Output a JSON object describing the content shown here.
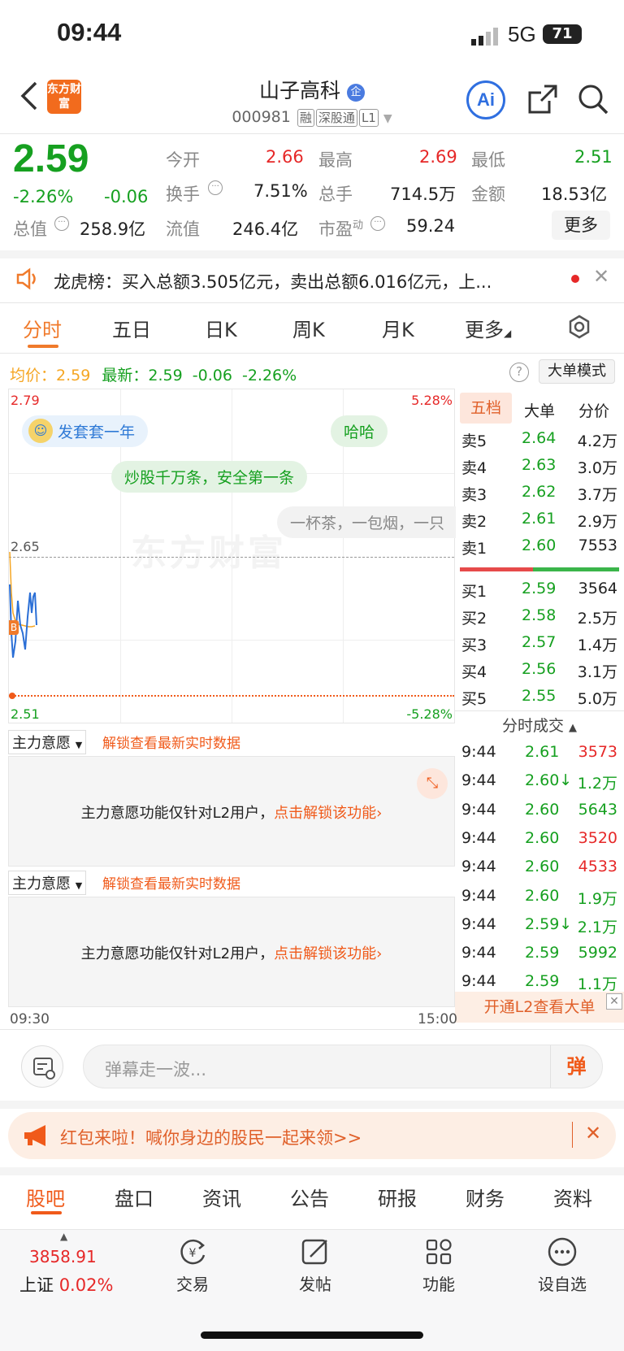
{
  "status": {
    "time": "09:44",
    "network": "5G",
    "battery": "71"
  },
  "header": {
    "title": "山子高科",
    "title_badge": "企",
    "code": "000981",
    "tags": [
      "融",
      "深股通",
      "L1"
    ],
    "logo_text": "东方财富",
    "ai_label": "Ai"
  },
  "quote": {
    "price": "2.59",
    "change_pct": "-2.26%",
    "change": "-0.06",
    "open_label": "今开",
    "open": "2.66",
    "high_label": "最高",
    "high": "2.69",
    "low_label": "最低",
    "low": "2.51",
    "turnover_label": "换手",
    "turnover": "7.51%",
    "volume_label": "总手",
    "volume": "714.5万",
    "amount_label": "金额",
    "amount": "18.53亿",
    "mktcap_label": "总值",
    "mktcap": "258.9亿",
    "float_label": "流值",
    "float": "246.4亿",
    "pe_label": "市盈",
    "pe_sup": "动",
    "pe": "59.24",
    "more": "更多"
  },
  "notice": {
    "text": "龙虎榜：买入总额3.505亿元，卖出总额6.016亿元，上..."
  },
  "chart_tabs": [
    "分时",
    "五日",
    "日K",
    "周K",
    "月K",
    "更多"
  ],
  "chart_info": {
    "avg_label": "均价：",
    "avg": "2.59",
    "latest_label": "最新：",
    "latest": "2.59",
    "chg": "-0.06",
    "pct": "-2.26%",
    "mode_btn": "大单模式"
  },
  "chart": {
    "y_max": "2.79",
    "y_max_pct": "5.28%",
    "y_mid": "2.65",
    "y_min": "2.51",
    "y_min_pct": "-5.28%",
    "t_start": "09:30",
    "t_end": "15:00",
    "watermark": "东方财富",
    "marker": "B"
  },
  "danmaku": [
    "发套套一年",
    "哈哈",
    "炒股千万条，安全第一条",
    "一杯茶，一包烟，一只"
  ],
  "order_book": {
    "tabs": [
      "五档",
      "大单",
      "分价"
    ],
    "asks": [
      {
        "label": "卖5",
        "price": "2.64",
        "vol": "4.2万"
      },
      {
        "label": "卖4",
        "price": "2.63",
        "vol": "3.0万"
      },
      {
        "label": "卖3",
        "price": "2.62",
        "vol": "3.7万"
      },
      {
        "label": "卖2",
        "price": "2.61",
        "vol": "2.9万"
      },
      {
        "label": "卖1",
        "price": "2.60",
        "vol": "7553"
      }
    ],
    "bids": [
      {
        "label": "买1",
        "price": "2.59",
        "vol": "3564"
      },
      {
        "label": "买2",
        "price": "2.58",
        "vol": "2.5万"
      },
      {
        "label": "买3",
        "price": "2.57",
        "vol": "1.4万"
      },
      {
        "label": "买4",
        "price": "2.56",
        "vol": "3.1万"
      },
      {
        "label": "买5",
        "price": "2.55",
        "vol": "5.0万"
      }
    ]
  },
  "trades": {
    "title": "分时成交",
    "rows": [
      {
        "t": "9:44",
        "p": "2.61",
        "v": "3573",
        "c": "red"
      },
      {
        "t": "9:44",
        "p": "2.60↓",
        "v": "1.2万",
        "c": "green"
      },
      {
        "t": "9:44",
        "p": "2.60",
        "v": "5643",
        "c": "green"
      },
      {
        "t": "9:44",
        "p": "2.60",
        "v": "3520",
        "c": "red"
      },
      {
        "t": "9:44",
        "p": "2.60",
        "v": "4533",
        "c": "red"
      },
      {
        "t": "9:44",
        "p": "2.60",
        "v": "1.9万",
        "c": "green"
      },
      {
        "t": "9:44",
        "p": "2.59↓",
        "v": "2.1万",
        "c": "green"
      },
      {
        "t": "9:44",
        "p": "2.59",
        "v": "5992",
        "c": "green"
      },
      {
        "t": "9:44",
        "p": "2.59",
        "v": "1.1万",
        "c": "green"
      }
    ],
    "l2_btn": "开通L2查看大单"
  },
  "l2_panels": [
    {
      "select": "主力意愿",
      "hint": "解锁查看最新实时数据",
      "msg": "主力意愿功能仅针对L2用户，",
      "link": "点击解锁该功能"
    },
    {
      "select": "主力意愿",
      "hint": "解锁查看最新实时数据",
      "msg": "主力意愿功能仅针对L2用户，",
      "link": "点击解锁该功能"
    }
  ],
  "comment": {
    "placeholder": "弹幕走一波...",
    "btn": "弹"
  },
  "promo": {
    "text": "红包来啦！喊你身边的股民一起来领>>"
  },
  "bottom_tabs": [
    "股吧",
    "盘口",
    "资讯",
    "公告",
    "研报",
    "财务",
    "资料"
  ],
  "index": {
    "value": "3858.91",
    "name": "上证",
    "pct": "0.02%"
  },
  "nav": [
    {
      "label": "交易",
      "icon": "trade-icon"
    },
    {
      "label": "发帖",
      "icon": "post-icon"
    },
    {
      "label": "功能",
      "icon": "apps-icon"
    },
    {
      "label": "设自选",
      "icon": "more-icon"
    }
  ]
}
